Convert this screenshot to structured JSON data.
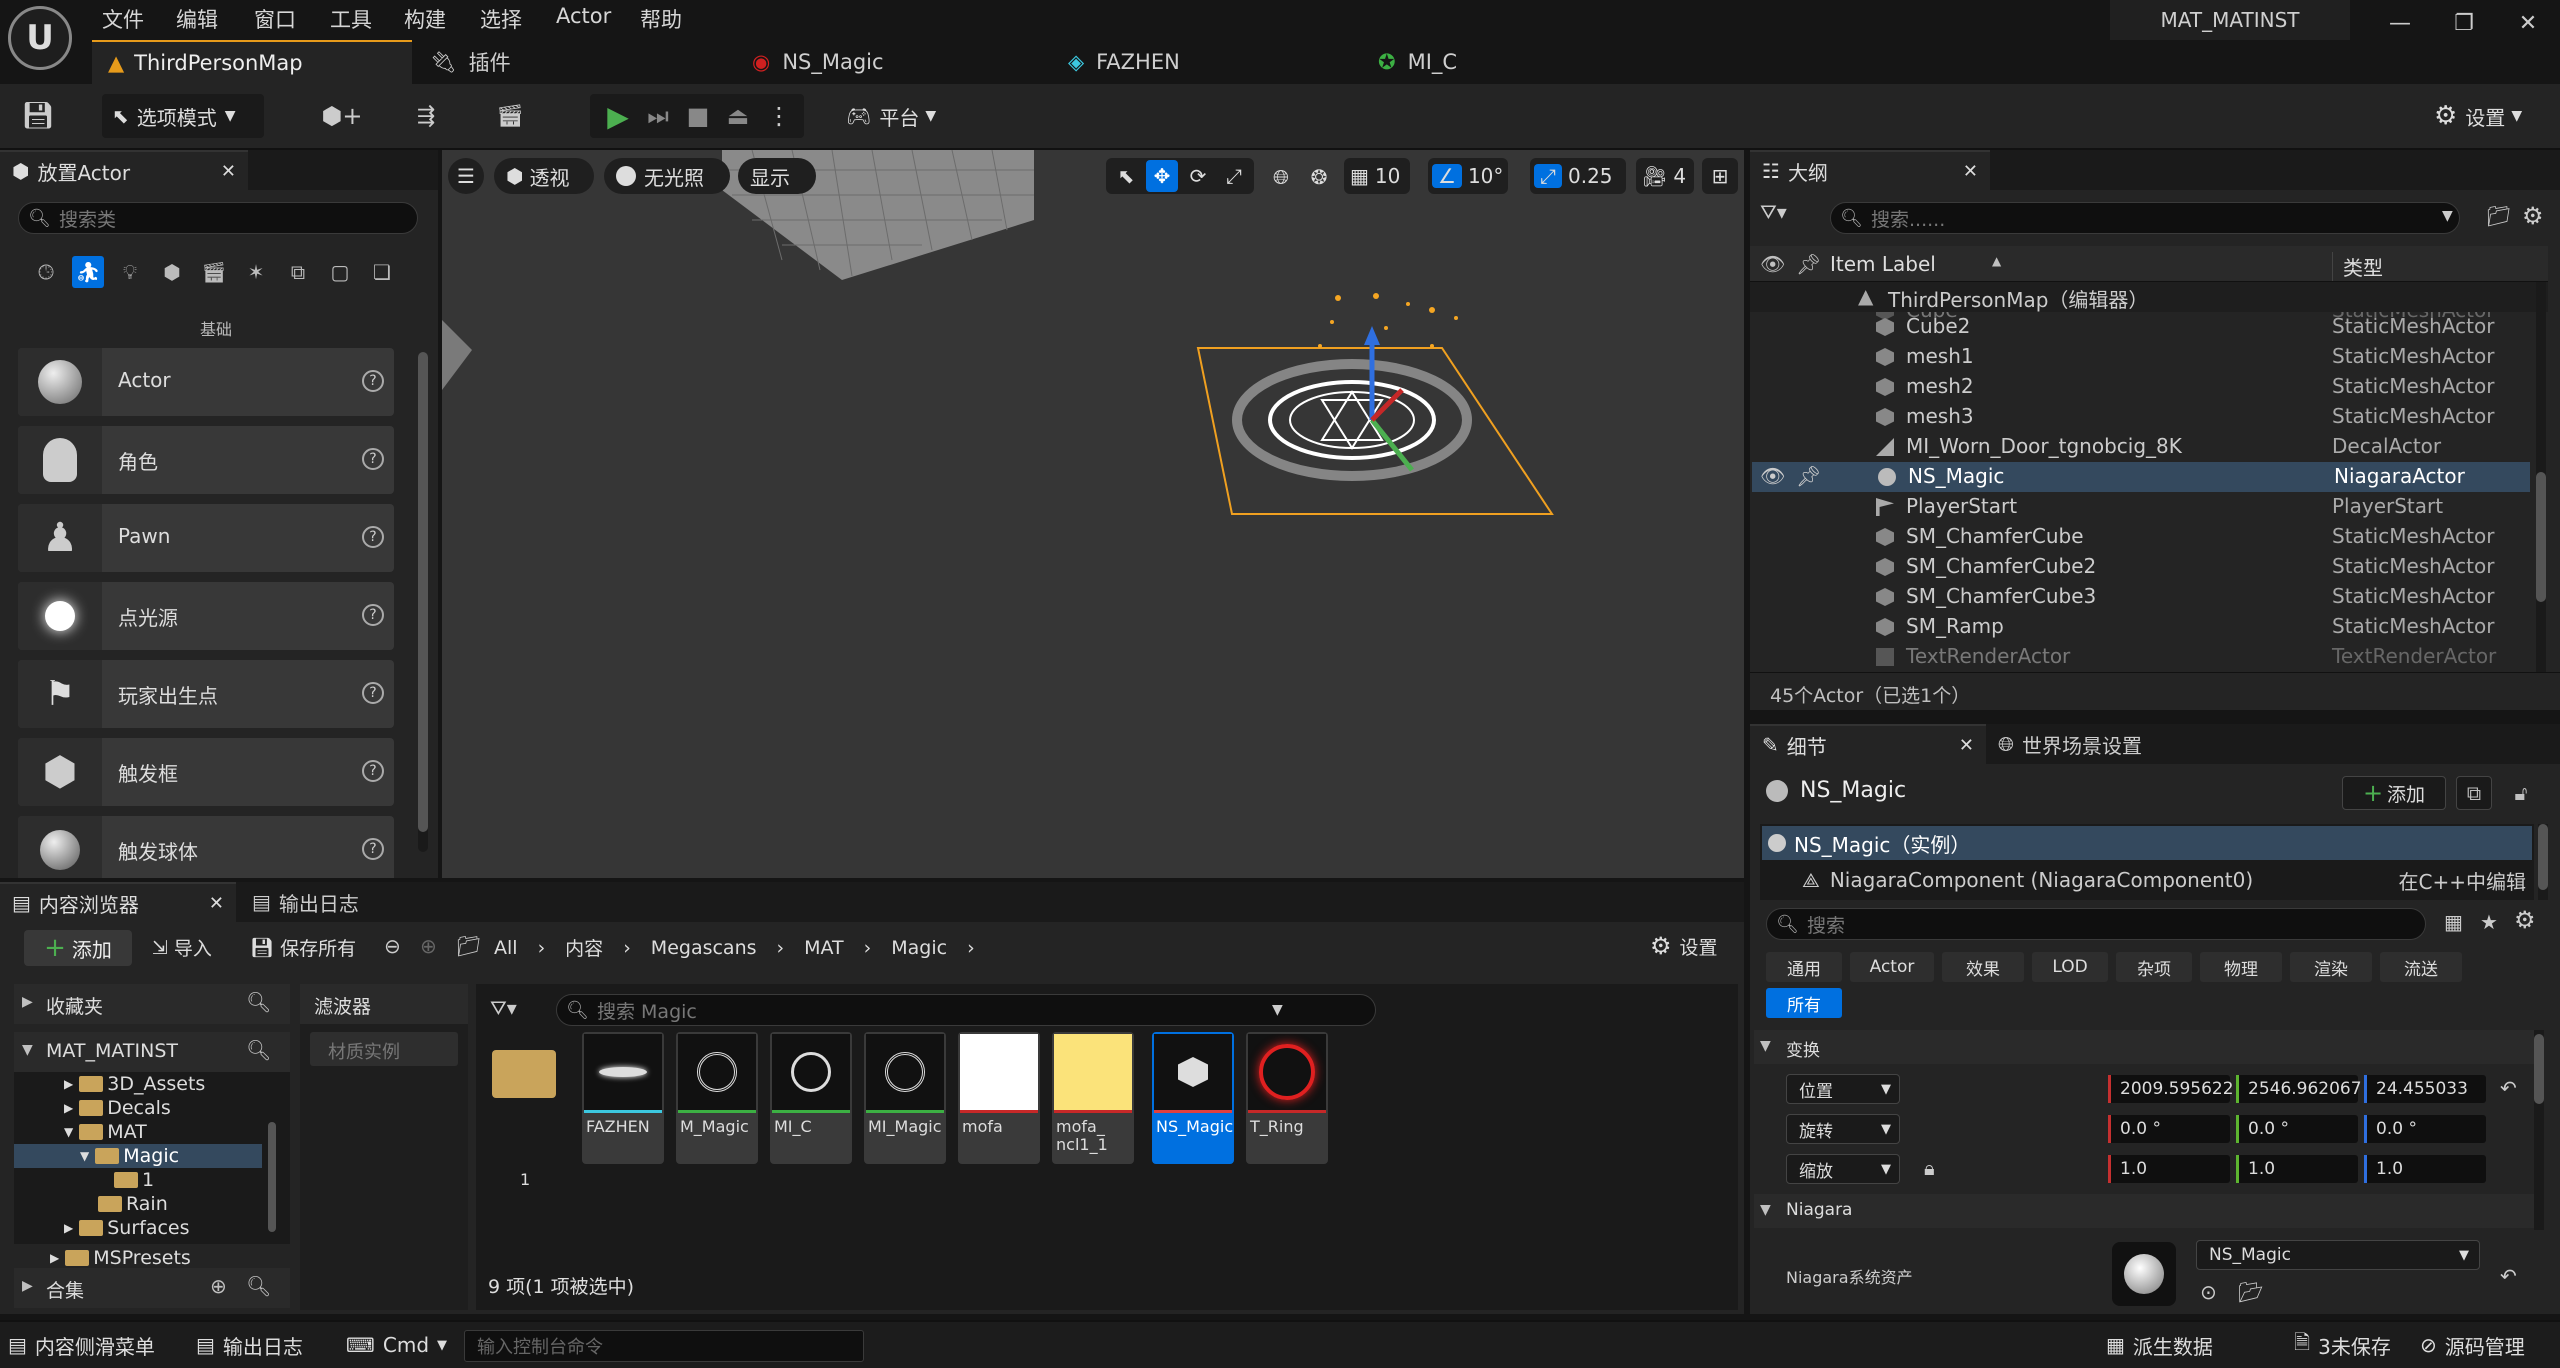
{
  "app": {
    "logo": "U",
    "title": "MAT_MATINST",
    "menus": [
      "文件",
      "编辑",
      "窗口",
      "工具",
      "构建",
      "选择",
      "Actor",
      "帮助"
    ]
  },
  "tabs": [
    {
      "label": "ThirdPersonMap"
    },
    {
      "label": "插件"
    },
    {
      "label": "NS_Magic"
    },
    {
      "label": "FAZHEN"
    },
    {
      "label": "MI_C"
    }
  ],
  "toolbar": {
    "mode": "选项模式",
    "platform": "平台",
    "settings": "设置"
  },
  "place_actor": {
    "title": "放置Actor",
    "search_placeholder": "搜索类",
    "category": "基础",
    "items": [
      "Actor",
      "角色",
      "Pawn",
      "点光源",
      "玩家出生点",
      "触发框",
      "触发球体"
    ]
  },
  "viewport": {
    "perspective": "透视",
    "lighting": "无光照",
    "show": "显示",
    "grid": "10",
    "angle": "10°",
    "scale": "0.25",
    "camera": "4"
  },
  "outliner": {
    "title": "大纲",
    "search_placeholder": "搜索......",
    "col_label": "Item Label",
    "col_type": "类型",
    "root": "ThirdPersonMap（编辑器）",
    "rows": [
      {
        "name": "Cube",
        "type": "StaticMeshActor"
      },
      {
        "name": "Cube2",
        "type": "StaticMeshActor"
      },
      {
        "name": "mesh1",
        "type": "StaticMeshActor"
      },
      {
        "name": "mesh2",
        "type": "StaticMeshActor"
      },
      {
        "name": "mesh3",
        "type": "StaticMeshActor"
      },
      {
        "name": "MI_Worn_Door_tgnobcig_8K",
        "type": "DecalActor"
      },
      {
        "name": "NS_Magic",
        "type": "NiagaraActor"
      },
      {
        "name": "PlayerStart",
        "type": "PlayerStart"
      },
      {
        "name": "SM_ChamferCube",
        "type": "StaticMeshActor"
      },
      {
        "name": "SM_ChamferCube2",
        "type": "StaticMeshActor"
      },
      {
        "name": "SM_ChamferCube3",
        "type": "StaticMeshActor"
      },
      {
        "name": "SM_Ramp",
        "type": "StaticMeshActor"
      },
      {
        "name": "TextRenderActor",
        "type": "TextRenderActor"
      }
    ],
    "count": "45个Actor（已选1个）"
  },
  "details": {
    "title": "细节",
    "world_settings": "世界场景设置",
    "object": "NS_Magic",
    "add": "添加",
    "instance": "NS_Magic（实例）",
    "component": "NiagaraComponent (NiagaraComponent0)",
    "edit_cpp": "在C++中编辑",
    "search_placeholder": "搜索",
    "filters": [
      "通用",
      "Actor",
      "效果",
      "LOD",
      "杂项",
      "物理",
      "渲染",
      "流送"
    ],
    "all": "所有",
    "transform": "变换",
    "location_label": "位置",
    "rotation_label": "旋转",
    "scale_label": "缩放",
    "location": [
      "2009.595622",
      "2546.962067",
      "24.455033"
    ],
    "rotation": [
      "0.0 °",
      "0.0 °",
      "0.0 °"
    ],
    "scale": [
      "1.0",
      "1.0",
      "1.0"
    ],
    "niagara_section": "Niagara",
    "niagara_asset_label": "Niagara系统资产",
    "niagara_asset": "NS_Magic"
  },
  "content_browser": {
    "title": "内容浏览器",
    "output_log": "输出日志",
    "add": "添加",
    "import": "导入",
    "save_all": "保存所有",
    "settings": "设置",
    "path": [
      "All",
      "内容",
      "Megascans",
      "MAT",
      "Magic"
    ],
    "favorites": "收藏夹",
    "project": "MAT_MATINST",
    "filters_label": "滤波器",
    "filter_chip": "材质实例",
    "search_placeholder": "搜索 Magic",
    "collections": "合集",
    "tree": [
      {
        "name": "3D_Assets",
        "level": 1
      },
      {
        "name": "Decals",
        "level": 1
      },
      {
        "name": "MAT",
        "level": 1
      },
      {
        "name": "Magic",
        "level": 2
      },
      {
        "name": "1",
        "level": 3
      },
      {
        "name": "Rain",
        "level": 2
      },
      {
        "name": "Surfaces",
        "level": 1
      },
      {
        "name": "MSPresets",
        "level": 0
      }
    ],
    "folder": "1",
    "assets": [
      {
        "name": "FAZHEN",
        "color": "#3cc8e0"
      },
      {
        "name": "M_Magic",
        "color": "#3cb043"
      },
      {
        "name": "MI_C",
        "color": "#3cb043"
      },
      {
        "name": "MI_Magic",
        "color": "#3cb043"
      },
      {
        "name": "mofa",
        "color": "#c62828"
      },
      {
        "name": "mofa_\nncl1_1",
        "color": "#c62828"
      },
      {
        "name": "NS_Magic",
        "color": "#e04040"
      },
      {
        "name": "T_Ring",
        "color": "#c62828"
      }
    ],
    "count": "9 项(1 项被选中)"
  },
  "statusbar": {
    "drawer": "内容侧滑菜单",
    "output": "输出日志",
    "cmd": "Cmd",
    "console_placeholder": "输入控制台命令",
    "derived": "派生数据",
    "unsaved": "3未保存",
    "source": "源码管理"
  }
}
